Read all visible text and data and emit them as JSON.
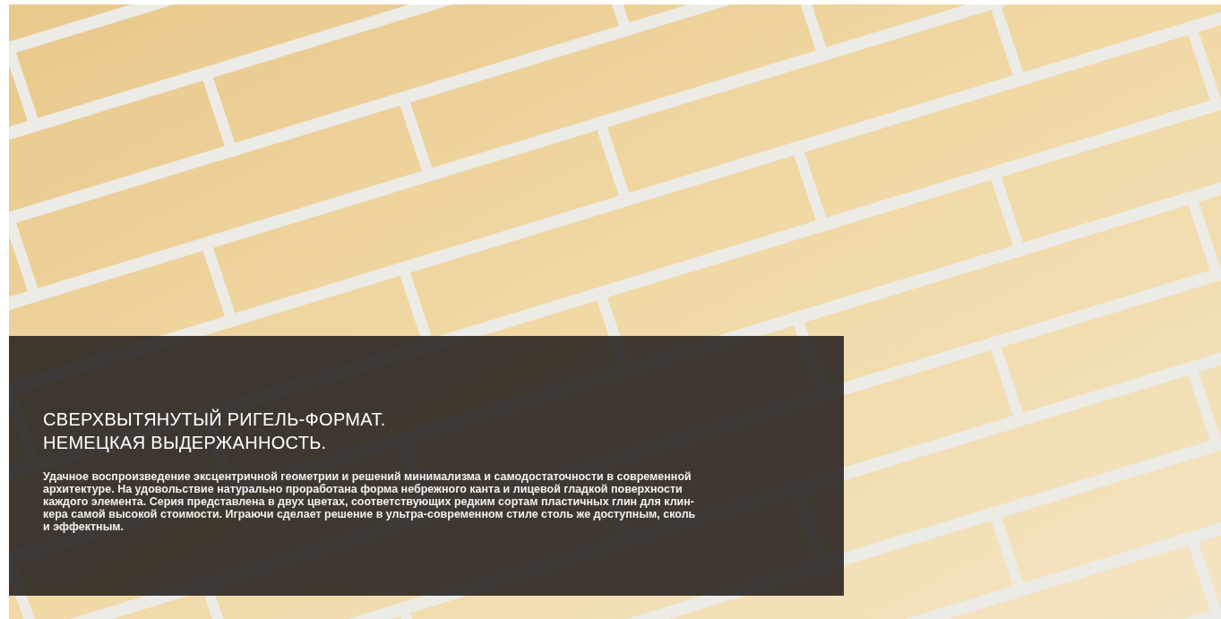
{
  "hero": {
    "title_lines": [
      "СВЕРХВЫТЯНУТЫЙ РИГЕЛЬ-ФОРМАТ.",
      "НЕМЕЦКАЯ ВЫДЕРЖАННОСТЬ."
    ],
    "description_lines": [
      "Удачное воспроизведение эксцентричной геометрии и решений минимализма и самодостаточности в современной",
      "архитектуре. На удовольствие натурально проработана форма небрежного канта и лицевой гладкой поверхности",
      "каждого элемента. Серия представлена в двух цветах, соответствующих редким сортам пластичных глин для клин-",
      "кера самой высокой стоимости. Играючи сделает решение в ультра-современном стиле столь же доступным, сколь",
      "и эффектным."
    ]
  }
}
